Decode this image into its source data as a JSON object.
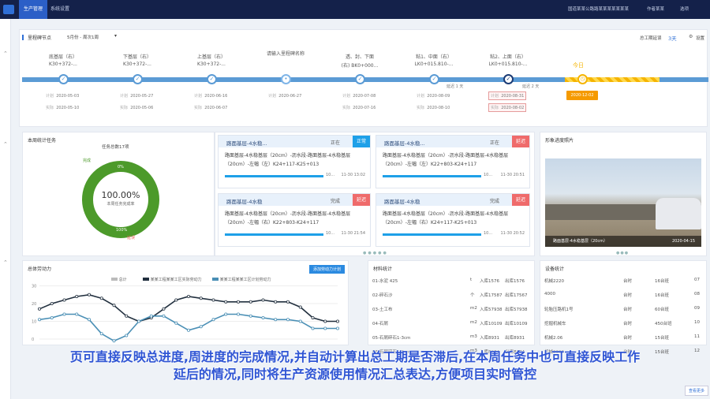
{
  "topbar": {
    "nav": [
      "生产管理",
      "系统设置"
    ],
    "org": "国道某某公路路某某某某某某某",
    "user": "作者某某",
    "extra": "选项"
  },
  "plan": {
    "title": "里程碑节点",
    "select": "5月份 - 周次1周",
    "count_label": "总工期延误",
    "count": "3天",
    "settings": "设置",
    "stages": [
      {
        "name": "底基层（右）",
        "code": "K30+372-...",
        "plan": "2020-05-03",
        "actual": "2020-05-10"
      },
      {
        "name": "下基层（右）",
        "code": "K30+372-...",
        "plan": "2020-05-27",
        "actual": "2020-05-06"
      },
      {
        "name": "上基层（右）",
        "code": "K30+372-...",
        "plan": "2020-06-16",
        "actual": "2020-06-07"
      },
      {
        "name": "",
        "code": "请输入里程碑名称",
        "plan": "2020-06-27",
        "actual": ""
      },
      {
        "name": "透、封、下面",
        "code": "(右) BK0+000...",
        "plan": "2020-07-08",
        "actual": "2020-07-16"
      },
      {
        "name": "粘1、中面（右）",
        "code": "LK0+015.810-...",
        "plan": "2020-08-09",
        "actual": "2020-08-10"
      },
      {
        "name": "粘2、上面（右）",
        "code": "LK0+015.810-...",
        "plan": "2020-08-31",
        "actual": "2020-08-02"
      }
    ],
    "delay1": "延迟 1 天",
    "delay2": "延迟 2 天",
    "today": "今日",
    "today_date": "2020-12-02",
    "plan_label": "计划",
    "actual_label": "实际"
  },
  "weekly": {
    "title": "本周统计任务",
    "total": "任务总数17项",
    "pct": "100.00%",
    "pct_sub": "本周任务完成率",
    "pie_top": "0%",
    "pie_bottom": "100%",
    "legend_a": "延误",
    "legend_b": "完成"
  },
  "tasks": [
    {
      "title": "路面基层-4水稳...",
      "state": "正在",
      "tag": "正常",
      "tagcolor": "#1ea0e8",
      "body": "路面基层-4水稳基层（20cm）-沥水段-路面基层-4水稳基层（20cm）-左幅（左）K24+117-K25+013",
      "pct": "10...",
      "time": "11-30 13:02"
    },
    {
      "title": "路面基层-4水稳...",
      "state": "正在",
      "tag": "延迟",
      "tagcolor": "#ef6b6b",
      "body": "路面基层-4水稳基层（20cm）-沥水段-路面基层-4水稳基层（20cm）-左幅（左）K22+803-K24+117",
      "pct": "10...",
      "time": "11-30 20:51"
    },
    {
      "title": "路面基层-4水稳",
      "state": "完成",
      "tag": "延迟",
      "tagcolor": "#ef6b6b",
      "body": "路面基层-4水稳基层（20cm）-沥水段-路面基层-4水稳基层（20cm）-左幅（右）K22+803-K24+117",
      "pct": "10...",
      "time": "11-30 21:54"
    },
    {
      "title": "路面基层-4水稳",
      "state": "完成",
      "tag": "延迟",
      "tagcolor": "#ef6b6b",
      "body": "路面基层-4水稳基层（20cm）-沥水段-路面基层-4水稳基层（20cm）-左幅（右）K24+117-K25+013",
      "pct": "10...",
      "time": "11-30 20:52"
    }
  ],
  "photo": {
    "title": "形象进度照片",
    "caption": "路面基层-4水稳基层（20cm）",
    "date": "2020-04-15"
  },
  "labor": {
    "title": "总体劳动力",
    "btn": "添加劳动力计划",
    "legend": [
      "总计",
      "某某工程某某工区实际劳动力",
      "某某工程某某工区计划劳动力"
    ],
    "yticks": [
      "30",
      "20",
      "10",
      "0"
    ]
  },
  "material": {
    "title": "材料统计",
    "rows": [
      [
        "01-水泥 425",
        "t",
        "入库1576",
        "出库1576"
      ],
      [
        "02-碎石沙",
        "个",
        "入库17587",
        "出库17567"
      ],
      [
        "03-土工布",
        "m2",
        "入库57938",
        "出库57938"
      ],
      [
        "04-石屑",
        "m2",
        "入库10109",
        "出库10109"
      ],
      [
        "05-石屑碎石1-3cm",
        "m3",
        "入库8931",
        "出库8931"
      ],
      [
        "06-石屑碎石1-3cm",
        "m3",
        "入库8074",
        "出库8074"
      ]
    ]
  },
  "equipment": {
    "title": "设备统计",
    "rows": [
      [
        "机械2220",
        "台时",
        "16台班",
        "07"
      ],
      [
        "4000",
        "台时",
        "16台班",
        "08"
      ],
      [
        "轮胎压路机1号",
        "台时",
        "60台班",
        "09"
      ],
      [
        "挖掘机械车",
        "台时",
        "450台班",
        "10"
      ],
      [
        "机械2.06",
        "台时",
        "15台班",
        "11"
      ],
      [
        "机械2300",
        "台时",
        "15台班",
        "12"
      ]
    ]
  },
  "bottom_right_btn": "查看更多",
  "subtitle_line1": "页可直接反映总进度,周进度的完成情况,并自动计算出总工期是否滞后,在本周任务中也可直接反映工作",
  "subtitle_line2": "延后的情况,同时将生产资源使用情况汇总表达,方便项目实时管控",
  "chart_data": {
    "type": "line",
    "categories": [
      "1",
      "2",
      "3",
      "4",
      "5",
      "6",
      "7",
      "8",
      "9",
      "10",
      "11",
      "12",
      "13",
      "14",
      "15",
      "16",
      "17",
      "18",
      "19",
      "20",
      "21",
      "22",
      "23",
      "24",
      "25"
    ],
    "series": [
      {
        "name": "某某工程某某工区实际劳动力",
        "values": [
          17,
          20,
          22,
          24,
          25,
          23,
          19,
          13,
          10,
          12,
          17,
          22,
          24,
          23,
          22,
          21,
          21,
          21,
          22,
          21,
          21,
          18,
          12,
          10,
          10
        ]
      },
      {
        "name": "某某工程某某工区计划劳动力",
        "values": [
          11,
          12,
          14,
          14,
          11,
          3,
          -1,
          2,
          10,
          13,
          13,
          9,
          5,
          7,
          11,
          14,
          14,
          13,
          12,
          11,
          11,
          10,
          6,
          6,
          6
        ]
      }
    ],
    "ylim": [
      0,
      32
    ]
  }
}
